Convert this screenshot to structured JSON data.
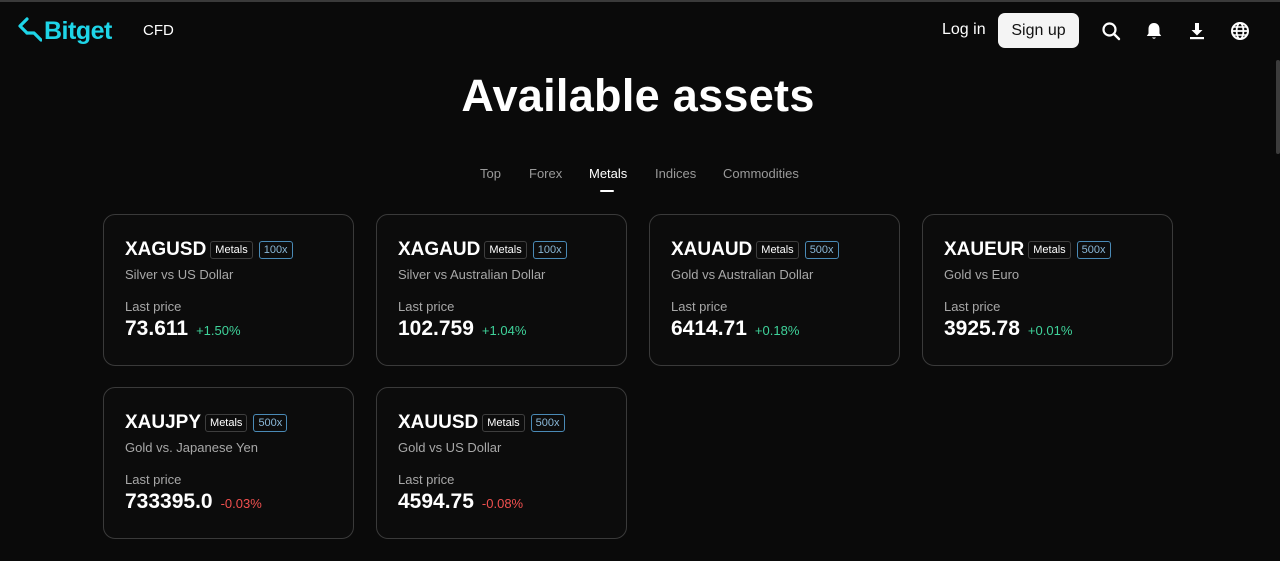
{
  "brand": {
    "logo_text": "Bitget",
    "accent": "#1ed5e8"
  },
  "nav": {
    "cfd_label": "CFD"
  },
  "header": {
    "login_label": "Log in",
    "signup_label": "Sign up",
    "icons": [
      "search-icon",
      "bell-icon",
      "download-icon",
      "globe-icon"
    ]
  },
  "page": {
    "title": "Available assets"
  },
  "tabs": [
    {
      "label": "Top",
      "active": false
    },
    {
      "label": "Forex",
      "active": false
    },
    {
      "label": "Metals",
      "active": true
    },
    {
      "label": "Indices",
      "active": false
    },
    {
      "label": "Commodities",
      "active": false
    }
  ],
  "colors": {
    "up": "#3fd29a",
    "down": "#f0504f",
    "leverage_border": "#4a8ab6"
  },
  "assets": [
    {
      "symbol": "XAGUSD",
      "category": "Metals",
      "leverage": "100x",
      "desc": "Silver vs US Dollar",
      "price_label": "Last price",
      "price": "73.611",
      "change": "+1.50%",
      "direction": "up"
    },
    {
      "symbol": "XAGAUD",
      "category": "Metals",
      "leverage": "100x",
      "desc": "Silver vs Australian Dollar",
      "price_label": "Last price",
      "price": "102.759",
      "change": "+1.04%",
      "direction": "up"
    },
    {
      "symbol": "XAUAUD",
      "category": "Metals",
      "leverage": "500x",
      "desc": "Gold vs Australian Dollar",
      "price_label": "Last price",
      "price": "6414.71",
      "change": "+0.18%",
      "direction": "up"
    },
    {
      "symbol": "XAUEUR",
      "category": "Metals",
      "leverage": "500x",
      "desc": "Gold vs Euro",
      "price_label": "Last price",
      "price": "3925.78",
      "change": "+0.01%",
      "direction": "up"
    },
    {
      "symbol": "XAUJPY",
      "category": "Metals",
      "leverage": "500x",
      "desc": "Gold vs. Japanese Yen",
      "price_label": "Last price",
      "price": "733395.0",
      "change": "-0.03%",
      "direction": "down"
    },
    {
      "symbol": "XAUUSD",
      "category": "Metals",
      "leverage": "500x",
      "desc": "Gold vs US Dollar",
      "price_label": "Last price",
      "price": "4594.75",
      "change": "-0.08%",
      "direction": "down"
    }
  ]
}
